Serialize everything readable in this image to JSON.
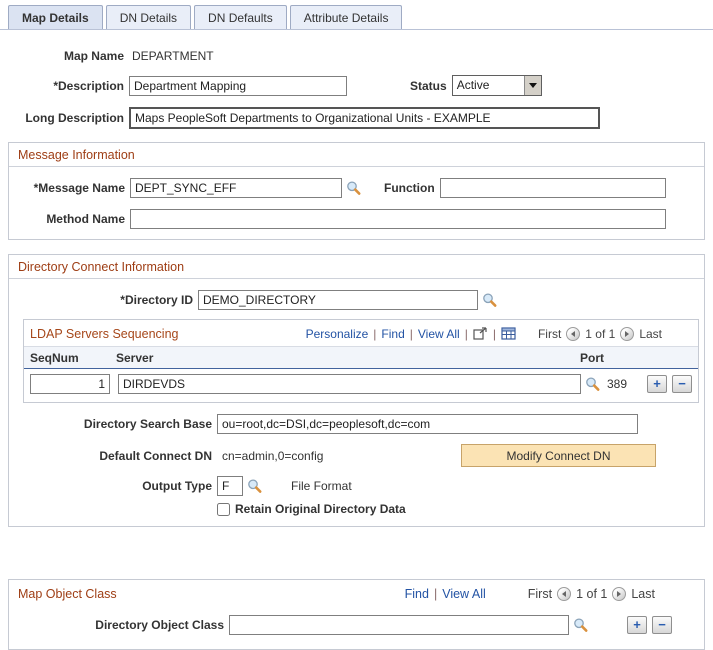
{
  "ui": {
    "sep": "|"
  },
  "colors": {
    "section_title": "#9e3d14",
    "grid_title": "#a6471a",
    "link": "#2353a4",
    "active_tab_bg": "#dbe3f2",
    "button_bg": "#fbe3b4",
    "grid_header_underline": "#42639d"
  },
  "tabs": [
    {
      "label": "Map Details",
      "active": true
    },
    {
      "label": "DN Details",
      "active": false
    },
    {
      "label": "DN Defaults",
      "active": false
    },
    {
      "label": "Attribute Details",
      "active": false
    }
  ],
  "form": {
    "map_name_label": "Map Name",
    "map_name_value": "DEPARTMENT",
    "description_label": "*Description",
    "description_value": "Department Mapping",
    "status_label": "Status",
    "status_value": "Active",
    "long_description_label": "Long Description",
    "long_description_value": "Maps PeopleSoft Departments to Organizational Units - EXAMPLE"
  },
  "message_info": {
    "title": "Message Information",
    "message_name_label": "*Message Name",
    "message_name_value": "DEPT_SYNC_EFF",
    "function_label": "Function",
    "function_value": "",
    "method_name_label": "Method Name",
    "method_name_value": ""
  },
  "directory_connect": {
    "title": "Directory Connect Information",
    "directory_id_label": "*Directory ID",
    "directory_id_value": "DEMO_DIRECTORY",
    "grid": {
      "title": "LDAP Servers Sequencing",
      "personalize": "Personalize",
      "find": "Find",
      "view_all": "View All",
      "nav": {
        "first": "First",
        "counter": "1 of 1",
        "last": "Last"
      },
      "columns": {
        "seqnum": "SeqNum",
        "server": "Server",
        "port": "Port"
      },
      "rows": [
        {
          "seqnum": "1",
          "server": "DIRDEVDS",
          "port": "389"
        }
      ],
      "add_label": "+",
      "remove_label": "−"
    },
    "search_base_label": "Directory Search Base",
    "search_base_value": "ou=root,dc=DSI,dc=peoplesoft,dc=com",
    "default_connect_dn_label": "Default Connect DN",
    "default_connect_dn_value": "cn=admin,0=config",
    "modify_connect_dn_button": "Modify Connect DN",
    "output_type_label": "Output Type",
    "output_type_value": "F",
    "output_type_desc": "File Format",
    "retain_checkbox_label": "Retain Original Directory Data"
  },
  "map_object_class": {
    "title": "Map Object Class",
    "find": "Find",
    "view_all": "View All",
    "nav": {
      "first": "First",
      "counter": "1 of 1",
      "last": "Last"
    },
    "directory_object_class_label": "Directory Object Class",
    "directory_object_class_value": "",
    "add_label": "+",
    "remove_label": "−"
  }
}
